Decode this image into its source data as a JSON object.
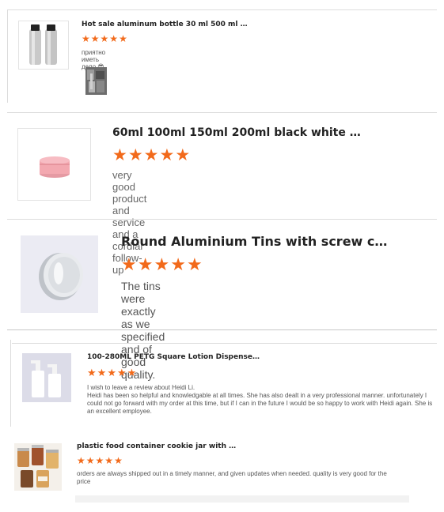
{
  "reviews": [
    {
      "product_title": "Hot sale aluminum bottle 30 ml 500 ml 1000 m...",
      "rating": 5,
      "review_text": "приятно иметь дело 😎",
      "product_image": "silver-aluminum-bottles-image",
      "review_photo": "customer-review-photo"
    },
    {
      "product_title": "60ml 100ml 150ml 200ml black white red matt...",
      "rating": 5,
      "review_text": "very good product and service and a cordial follow-up",
      "product_image": "pink-cosmetic-jar-image"
    },
    {
      "product_title": "Round Aluminium Tins with screw cap 30ml 50...",
      "rating": 5,
      "review_text": "The tins were exactly as we specified and of good quality.",
      "product_image": "silver-round-tin-image"
    },
    {
      "product_title": "100-280ML PETG Square Lotion Dispenser Bot...",
      "rating": 5,
      "review_text": "I wish to leave a review about Heidi Li.\nHeidi has been so helpful and knowledgable at all times. She has also dealt in a very professional manner. unfortunately I could not go forward with my order at this time, but if I can in the future I would be so happy to work with Heidi again. She is an excellent employee.",
      "product_image": "white-lotion-pump-bottles-image"
    },
    {
      "product_title": "plastic food container cookie jar with aluminu...",
      "rating": 5,
      "review_text": "orders are always shipped out in a timely manner, and given updates when needed. quality is very good for the price",
      "product_image": "cookie-jars-image"
    }
  ],
  "star_glyph": "★",
  "colors": {
    "star": "#f26a1b",
    "divider": "#dcdcdc"
  }
}
